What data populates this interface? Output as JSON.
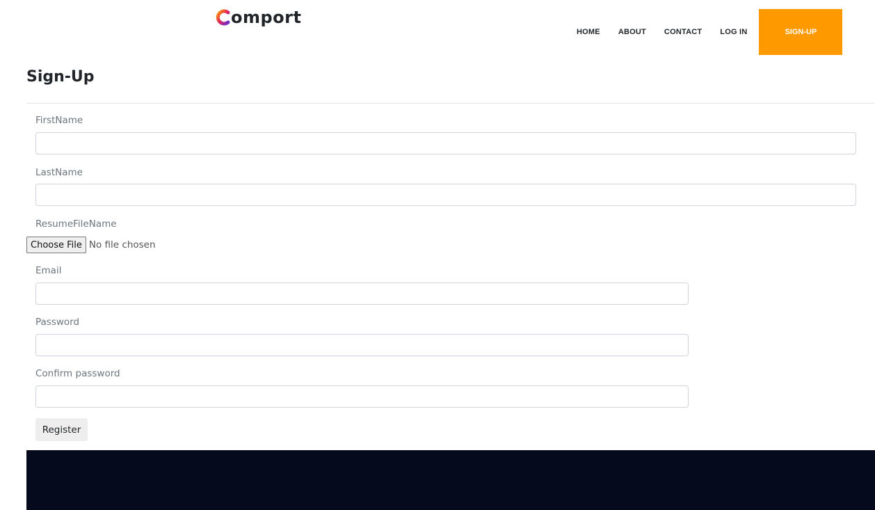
{
  "brand": {
    "logo_text": "omport",
    "logo_colors": [
      "#ff9900",
      "#e0245e",
      "#6a2fcf"
    ]
  },
  "nav": {
    "items": [
      {
        "label": "HOME"
      },
      {
        "label": "ABOUT"
      },
      {
        "label": "CONTACT"
      },
      {
        "label": "LOG IN"
      }
    ],
    "cta_label": "SIGN-UP",
    "cta_color": "#ff9900"
  },
  "page": {
    "title": "Sign-Up"
  },
  "form": {
    "first_name": {
      "label": "FirstName",
      "value": ""
    },
    "last_name": {
      "label": "LastName",
      "value": ""
    },
    "resume": {
      "label": "ResumeFileName",
      "button_label": "Choose File",
      "status": "No file chosen"
    },
    "email": {
      "label": "Email",
      "value": ""
    },
    "password": {
      "label": "Password",
      "value": ""
    },
    "confirm_password": {
      "label": "Confirm password",
      "value": ""
    },
    "submit_label": "Register"
  },
  "footer": {
    "background": "#050a1c"
  }
}
